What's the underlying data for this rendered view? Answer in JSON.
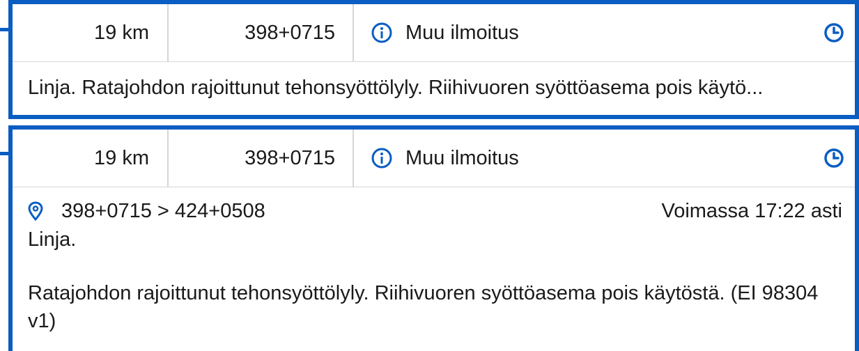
{
  "colors": {
    "accent": "#0a5dc2",
    "divider": "#d6d6d6",
    "text": "#1a1a1a"
  },
  "notices": [
    {
      "distance": "19 km",
      "km_position": "398+0715",
      "type_label": "Muu ilmoitus",
      "type_icon": "info-icon",
      "time_icon": "clock-icon",
      "summary": "Linja. Ratajohdon rajoittunut tehonsyöttölyly. Riihivuoren syöttöasema pois käytö..."
    },
    {
      "distance": "19 km",
      "km_position": "398+0715",
      "type_label": "Muu ilmoitus",
      "type_icon": "info-icon",
      "time_icon": "clock-icon",
      "location_icon": "map-pin-icon",
      "location_range": "398+0715 > 424+0508",
      "valid_until": "Voimassa 17:22 asti",
      "line_label": "Linja.",
      "description": "Ratajohdon rajoittunut tehonsyöttölyly. Riihivuoren syöttöasema pois käytöstä. (EI 98304 v1)"
    }
  ]
}
